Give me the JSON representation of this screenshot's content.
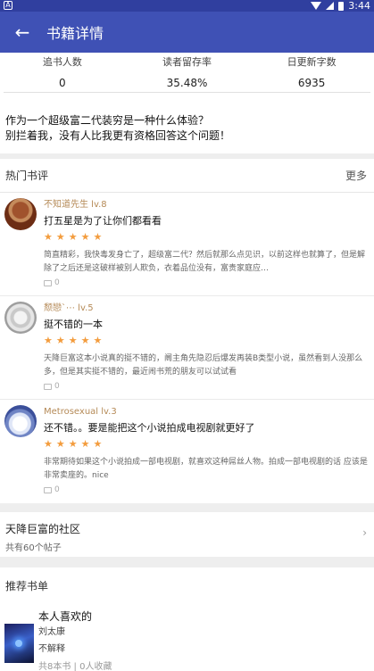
{
  "status_bar": {
    "time": "3:44",
    "notif_icon": "A"
  },
  "app_bar": {
    "title": "书籍详情"
  },
  "stats": [
    {
      "label": "追书人数",
      "value": "0"
    },
    {
      "label": "读者留存率",
      "value": "35.48%"
    },
    {
      "label": "日更新字数",
      "value": "6935"
    }
  ],
  "intro": {
    "line1": "作为一个超级富二代装穷是一种什么体验？",
    "line2": "别拦着我，没有人比我更有资格回答这个问题！"
  },
  "hot_reviews": {
    "title": "热门书评",
    "more": "更多",
    "items": [
      {
        "user": "不知道先生 lv.8",
        "title": "打五星是为了让你们都看看",
        "stars": 5,
        "text": "简直精彩，我快毒发身亡了，超级富二代？然后就那么点见识，以前这样也就算了，但是解除了之后还是这破样被别人欺负，衣着品位没有，富贵家庭应…",
        "likes": "0"
      },
      {
        "user": "颓戀`⋯ lv.5",
        "title": "挺不错的一本",
        "stars": 5,
        "text": "天降巨富这本小说真的挺不错的，阛主角先隐忍后爆发再装B类型小说，虽然看到人没那么多，但是其实挺不错的，最近闹书荒的朋友可以试试看",
        "likes": "0"
      },
      {
        "user": "Metrosexual lv.3",
        "title": "还不错。。要是能把这个小说拍成电视剧就更好了",
        "stars": 5,
        "text": "非常期待如果这个小说拍成一部电视剧，就喜欢这种屌丝人物。拍成一部电视剧的话 应该是非常卖座的。nice",
        "likes": "0"
      }
    ]
  },
  "community": {
    "name": "天降巨富的社区",
    "sub": "共有60个帖子"
  },
  "booklist": {
    "title": "推荐书单",
    "book_title": "本人喜欢的",
    "author": "刘太康",
    "desc": "不解释",
    "meta": "共8本书 | 0人收藏"
  }
}
